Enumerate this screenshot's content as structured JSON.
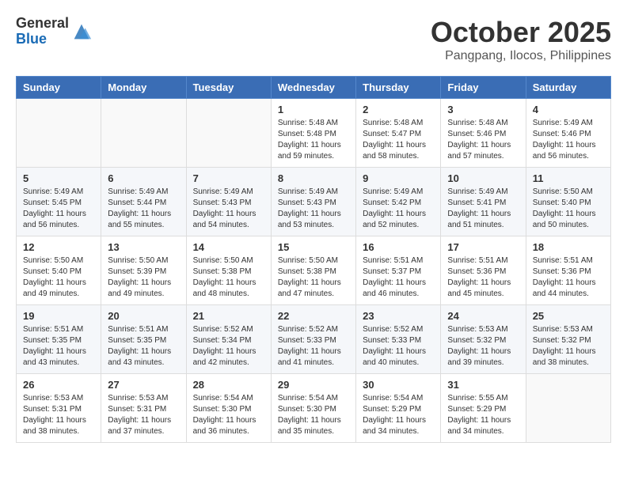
{
  "header": {
    "logo_general": "General",
    "logo_blue": "Blue",
    "month_title": "October 2025",
    "location": "Pangpang, Ilocos, Philippines"
  },
  "calendar": {
    "days_of_week": [
      "Sunday",
      "Monday",
      "Tuesday",
      "Wednesday",
      "Thursday",
      "Friday",
      "Saturday"
    ],
    "weeks": [
      [
        {
          "day": "",
          "info": ""
        },
        {
          "day": "",
          "info": ""
        },
        {
          "day": "",
          "info": ""
        },
        {
          "day": "1",
          "info": "Sunrise: 5:48 AM\nSunset: 5:48 PM\nDaylight: 11 hours\nand 59 minutes."
        },
        {
          "day": "2",
          "info": "Sunrise: 5:48 AM\nSunset: 5:47 PM\nDaylight: 11 hours\nand 58 minutes."
        },
        {
          "day": "3",
          "info": "Sunrise: 5:48 AM\nSunset: 5:46 PM\nDaylight: 11 hours\nand 57 minutes."
        },
        {
          "day": "4",
          "info": "Sunrise: 5:49 AM\nSunset: 5:46 PM\nDaylight: 11 hours\nand 56 minutes."
        }
      ],
      [
        {
          "day": "5",
          "info": "Sunrise: 5:49 AM\nSunset: 5:45 PM\nDaylight: 11 hours\nand 56 minutes."
        },
        {
          "day": "6",
          "info": "Sunrise: 5:49 AM\nSunset: 5:44 PM\nDaylight: 11 hours\nand 55 minutes."
        },
        {
          "day": "7",
          "info": "Sunrise: 5:49 AM\nSunset: 5:43 PM\nDaylight: 11 hours\nand 54 minutes."
        },
        {
          "day": "8",
          "info": "Sunrise: 5:49 AM\nSunset: 5:43 PM\nDaylight: 11 hours\nand 53 minutes."
        },
        {
          "day": "9",
          "info": "Sunrise: 5:49 AM\nSunset: 5:42 PM\nDaylight: 11 hours\nand 52 minutes."
        },
        {
          "day": "10",
          "info": "Sunrise: 5:49 AM\nSunset: 5:41 PM\nDaylight: 11 hours\nand 51 minutes."
        },
        {
          "day": "11",
          "info": "Sunrise: 5:50 AM\nSunset: 5:40 PM\nDaylight: 11 hours\nand 50 minutes."
        }
      ],
      [
        {
          "day": "12",
          "info": "Sunrise: 5:50 AM\nSunset: 5:40 PM\nDaylight: 11 hours\nand 49 minutes."
        },
        {
          "day": "13",
          "info": "Sunrise: 5:50 AM\nSunset: 5:39 PM\nDaylight: 11 hours\nand 49 minutes."
        },
        {
          "day": "14",
          "info": "Sunrise: 5:50 AM\nSunset: 5:38 PM\nDaylight: 11 hours\nand 48 minutes."
        },
        {
          "day": "15",
          "info": "Sunrise: 5:50 AM\nSunset: 5:38 PM\nDaylight: 11 hours\nand 47 minutes."
        },
        {
          "day": "16",
          "info": "Sunrise: 5:51 AM\nSunset: 5:37 PM\nDaylight: 11 hours\nand 46 minutes."
        },
        {
          "day": "17",
          "info": "Sunrise: 5:51 AM\nSunset: 5:36 PM\nDaylight: 11 hours\nand 45 minutes."
        },
        {
          "day": "18",
          "info": "Sunrise: 5:51 AM\nSunset: 5:36 PM\nDaylight: 11 hours\nand 44 minutes."
        }
      ],
      [
        {
          "day": "19",
          "info": "Sunrise: 5:51 AM\nSunset: 5:35 PM\nDaylight: 11 hours\nand 43 minutes."
        },
        {
          "day": "20",
          "info": "Sunrise: 5:51 AM\nSunset: 5:35 PM\nDaylight: 11 hours\nand 43 minutes."
        },
        {
          "day": "21",
          "info": "Sunrise: 5:52 AM\nSunset: 5:34 PM\nDaylight: 11 hours\nand 42 minutes."
        },
        {
          "day": "22",
          "info": "Sunrise: 5:52 AM\nSunset: 5:33 PM\nDaylight: 11 hours\nand 41 minutes."
        },
        {
          "day": "23",
          "info": "Sunrise: 5:52 AM\nSunset: 5:33 PM\nDaylight: 11 hours\nand 40 minutes."
        },
        {
          "day": "24",
          "info": "Sunrise: 5:53 AM\nSunset: 5:32 PM\nDaylight: 11 hours\nand 39 minutes."
        },
        {
          "day": "25",
          "info": "Sunrise: 5:53 AM\nSunset: 5:32 PM\nDaylight: 11 hours\nand 38 minutes."
        }
      ],
      [
        {
          "day": "26",
          "info": "Sunrise: 5:53 AM\nSunset: 5:31 PM\nDaylight: 11 hours\nand 38 minutes."
        },
        {
          "day": "27",
          "info": "Sunrise: 5:53 AM\nSunset: 5:31 PM\nDaylight: 11 hours\nand 37 minutes."
        },
        {
          "day": "28",
          "info": "Sunrise: 5:54 AM\nSunset: 5:30 PM\nDaylight: 11 hours\nand 36 minutes."
        },
        {
          "day": "29",
          "info": "Sunrise: 5:54 AM\nSunset: 5:30 PM\nDaylight: 11 hours\nand 35 minutes."
        },
        {
          "day": "30",
          "info": "Sunrise: 5:54 AM\nSunset: 5:29 PM\nDaylight: 11 hours\nand 34 minutes."
        },
        {
          "day": "31",
          "info": "Sunrise: 5:55 AM\nSunset: 5:29 PM\nDaylight: 11 hours\nand 34 minutes."
        },
        {
          "day": "",
          "info": ""
        }
      ]
    ]
  }
}
